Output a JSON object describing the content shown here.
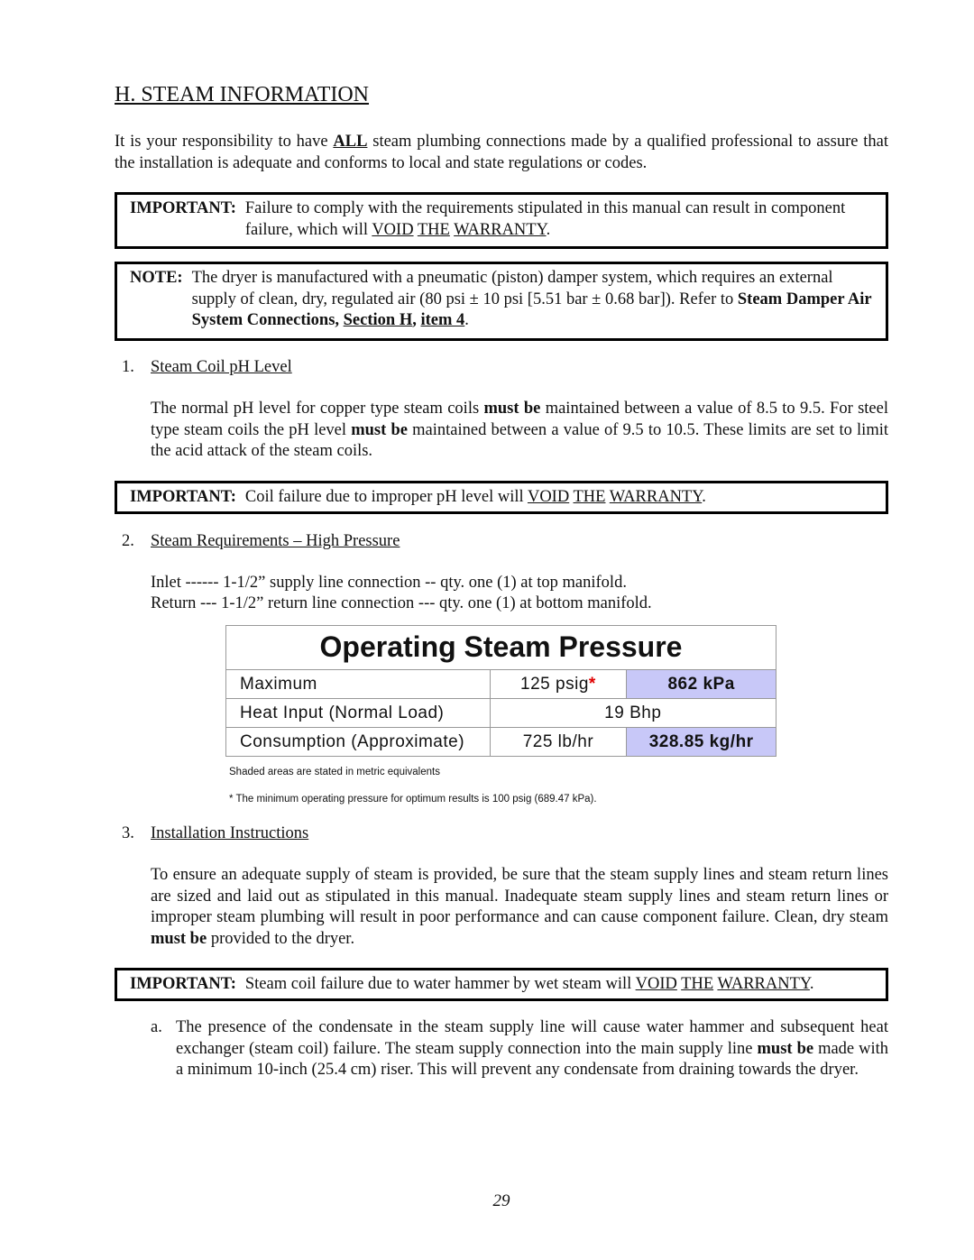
{
  "heading": "H.  STEAM INFORMATION",
  "intro": [
    {
      "t": "It is your responsibility to have "
    },
    {
      "t": "ALL",
      "b": 1,
      "u": 1
    },
    {
      "t": " steam plumbing connections made by a qualified professional to assure that the installation is adequate and conforms to local and state regulations or codes."
    }
  ],
  "box1": {
    "label": "IMPORTANT:",
    "text": [
      {
        "t": "Failure to comply with the requirements stipulated in this manual can result in component failure, which will "
      },
      {
        "t": "VOID",
        "u": 1
      },
      {
        "t": " "
      },
      {
        "t": "THE",
        "u": 1
      },
      {
        "t": " "
      },
      {
        "t": "WARRANTY",
        "u": 1
      },
      {
        "t": "."
      }
    ]
  },
  "box2": {
    "label": "NOTE:",
    "text": [
      {
        "t": "The dryer is manufactured with a pneumatic (piston) damper system, which requires an external supply of clean, dry, regulated air (80 psi ± 10 psi [5.51 bar ± 0.68 bar]).  Refer to "
      },
      {
        "t": "Steam Damper Air System Connections",
        "b": 1
      },
      {
        "t": ", ",
        "b": 1
      },
      {
        "t": "Section H",
        "b": 1,
        "u": 1
      },
      {
        "t": ", ",
        "b": 1
      },
      {
        "t": "item 4",
        "b": 1,
        "u": 1
      },
      {
        "t": "."
      }
    ]
  },
  "item1": {
    "num": "1.",
    "title": "Steam Coil pH Level",
    "text": [
      {
        "t": "The normal pH level for copper type steam coils "
      },
      {
        "t": "must be",
        "b": 1
      },
      {
        "t": " maintained between a value of 8.5 to 9.5.  For steel type steam coils the pH level "
      },
      {
        "t": "must be",
        "b": 1
      },
      {
        "t": " maintained between a value of 9.5 to 10.5.  These limits are set to limit the acid attack of the steam coils."
      }
    ]
  },
  "box3": {
    "label": "IMPORTANT:",
    "text": [
      {
        "t": "Coil failure due to improper pH level will "
      },
      {
        "t": "VOID",
        "u": 1
      },
      {
        "t": " "
      },
      {
        "t": "THE",
        "u": 1
      },
      {
        "t": " "
      },
      {
        "t": "WARRANTY",
        "u": 1
      },
      {
        "t": "."
      }
    ]
  },
  "item2": {
    "num": "2.",
    "title": "Steam Requirements – High Pressure",
    "inlet": "Inlet ------  1-1/2” supply line connection -- qty. one (1) at top manifold.",
    "return": "Return ---  1-1/2” return line connection --- qty. one (1) at bottom manifold."
  },
  "table": {
    "title": "Operating Steam Pressure",
    "rows": [
      {
        "label": "Maximum",
        "value": "125 psig",
        "star": "*",
        "metric": "862 kPa"
      },
      {
        "label": "Heat Input (Normal Load)",
        "value": "19 Bhp"
      },
      {
        "label": "Consumption (Approximate)",
        "value": "725 lb/hr",
        "metric": "328.85 kg/hr"
      }
    ],
    "shade_color": "#c8c8f8",
    "note1": "Shaded areas are stated in metric equivalents",
    "note2": "*  The minimum operating pressure for optimum results is 100 psig (689.47 kPa)."
  },
  "item3": {
    "num": "3.",
    "title": "Installation Instructions",
    "text": [
      {
        "t": "To ensure an adequate supply of steam is provided, be sure that the steam supply lines and steam return lines are sized and laid out as stipulated in this manual.  Inadequate steam supply lines and steam return lines or improper steam plumbing will result in poor performance and can cause component failure.  Clean, dry steam "
      },
      {
        "t": "must be",
        "b": 1
      },
      {
        "t": " provided to the dryer."
      }
    ]
  },
  "box4": {
    "label": "IMPORTANT:",
    "text": [
      {
        "t": "Steam coil failure due to water hammer by wet steam will "
      },
      {
        "t": "VOID",
        "u": 1
      },
      {
        "t": " "
      },
      {
        "t": "THE",
        "u": 1
      },
      {
        "t": " "
      },
      {
        "t": "WARRANTY",
        "u": 1
      },
      {
        "t": "."
      }
    ]
  },
  "sub_a": {
    "num": "a.",
    "text": [
      {
        "t": "The presence of the condensate in the steam supply line will cause water hammer and subsequent heat exchanger (steam coil) failure.  The steam supply connection into the main supply line "
      },
      {
        "t": "must be",
        "b": 1
      },
      {
        "t": " made with a minimum 10-inch (25.4 cm) riser.  This will prevent any condensate from draining towards the dryer."
      }
    ]
  },
  "page_number": "29"
}
